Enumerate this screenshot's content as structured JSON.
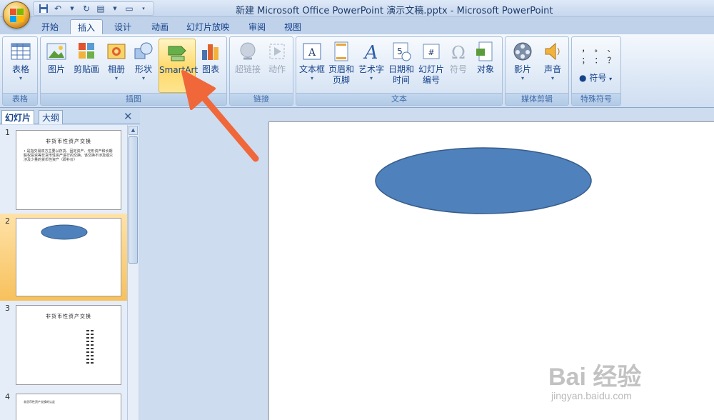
{
  "window": {
    "title": "新建 Microsoft Office PowerPoint 演示文稿.pptx - Microsoft PowerPoint"
  },
  "tabs": [
    "开始",
    "插入",
    "设计",
    "动画",
    "幻灯片放映",
    "审阅",
    "视图"
  ],
  "active_tab": "插入",
  "ribbon": {
    "groups": {
      "tables": "表格",
      "illustrations": "插图",
      "links": "链接",
      "text": "文本",
      "media": "媒体剪辑",
      "symbols": "特殊符号"
    },
    "buttons": {
      "table": "表格",
      "picture": "图片",
      "clipart": "剪贴画",
      "album": "相册",
      "shapes": "形状",
      "smartart": "SmartArt",
      "chart": "图表",
      "hyperlink": "超链接",
      "action": "动作",
      "textbox": "文本框",
      "header_footer_1": "页眉和",
      "header_footer_2": "页脚",
      "wordart": "艺术字",
      "datetime_1": "日期和",
      "datetime_2": "时间",
      "slide_number_1": "幻灯片",
      "slide_number_2": "编号",
      "symbol": "符号",
      "object": "对象",
      "movie": "影片",
      "sound": "声音",
      "special_symbol": "符号"
    },
    "symbol_chars": [
      "，",
      "。",
      "、",
      "；",
      "：",
      "？"
    ]
  },
  "pane": {
    "tab_slides": "幻灯片",
    "tab_outline": "大纲"
  },
  "slides": [
    {
      "num": "1",
      "title": "非货币性资产交换",
      "body": "• 是指交易双方主要以存货、固定资产、无形资产和长期股权投资等非货币性资产进行的交换。该交换不涉及或只涉及少量的货币性资产（即补价）"
    },
    {
      "num": "2"
    },
    {
      "num": "3",
      "title": "非货币性资产交换"
    },
    {
      "num": "4",
      "title": "非货币性资产交换的认定"
    }
  ],
  "watermark": {
    "brand": "Bai 经验",
    "url": "jingyan.baidu.com"
  },
  "colors": {
    "shape_fill": "#4f81bd",
    "shape_stroke": "#385d8a",
    "arrow": "#f0673a"
  }
}
